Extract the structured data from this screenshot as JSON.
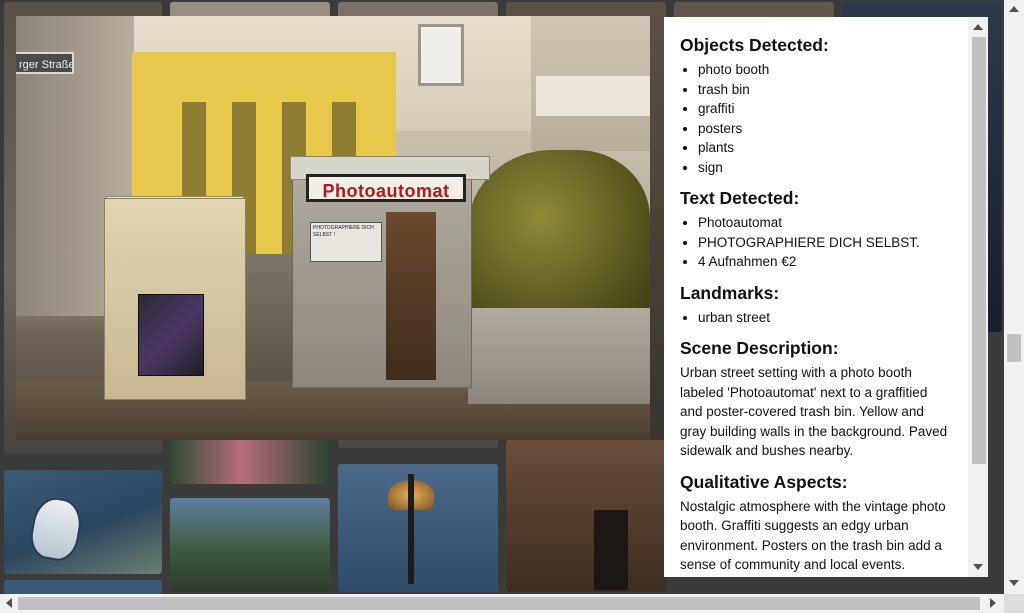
{
  "photo": {
    "street_sign": "rger Straße",
    "booth_label": "Photoautomat",
    "booth_panel_text": "PHOTOGRAPHIERE DICH SELBST !"
  },
  "info": {
    "objects": {
      "heading": "Objects Detected:",
      "items": [
        "photo booth",
        "trash bin",
        "graffiti",
        "posters",
        "plants",
        "sign"
      ]
    },
    "text": {
      "heading": "Text Detected:",
      "items": [
        "Photoautomat",
        "PHOTOGRAPHIERE DICH SELBST.",
        "4 Aufnahmen €2"
      ]
    },
    "landmarks": {
      "heading": "Landmarks:",
      "items": [
        "urban street"
      ]
    },
    "scene": {
      "heading": "Scene Description:",
      "body": "Urban street setting with a photo booth labeled 'Photoautomat' next to a graffitied and poster-covered trash bin. Yellow and gray building walls in the background. Paved sidewalk and bushes nearby."
    },
    "qualitative": {
      "heading": "Qualitative Aspects:",
      "body": "Nostalgic atmosphere with the vintage photo booth. Graffiti suggests an edgy urban environment. Posters on the trash bin add a sense of community and local events."
    }
  }
}
